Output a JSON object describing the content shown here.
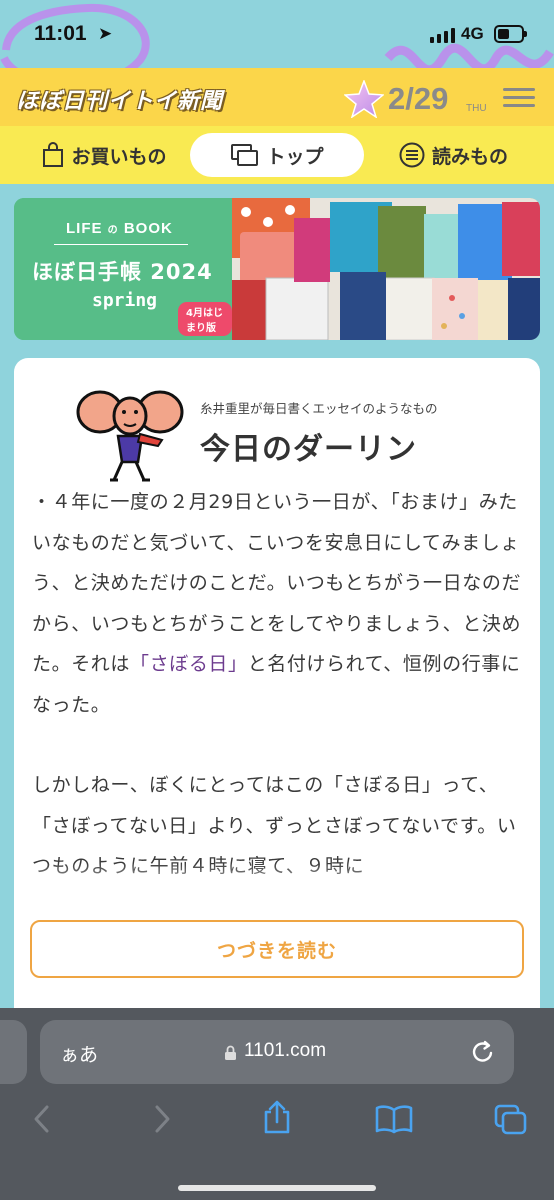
{
  "status_bar": {
    "time": "11:01",
    "network": "4G"
  },
  "header": {
    "logo": "ほぼ日刊イトイ新聞",
    "date": "2/29",
    "day_of_week": "THU"
  },
  "tabs": [
    {
      "label": "お買いもの",
      "icon": "shopping-bag-icon"
    },
    {
      "label": "トップ",
      "icon": "windows-icon",
      "active": true
    },
    {
      "label": "読みもの",
      "icon": "reading-icon"
    }
  ],
  "banner": {
    "brand_prefix": "LIFE",
    "brand_mid": "の",
    "brand_suffix": "BOOK",
    "title": "ほぼ日手帳 2024",
    "season": "spring",
    "badge": "4月はじまり版"
  },
  "article": {
    "kicker": "糸井重里が毎日書くエッセイのようなもの",
    "title": "今日のダーリン",
    "para1_part1": "・４年に一度の２月29日という一日が、「おまけ」みたいなものだと気づいて、こいつを安息日にしてみましょう、と決めただけのことだ。いつもとちがう一日なのだから、いつもとちがうことをしてやりましょう、と決めた。それは",
    "para1_link": "「さぼる日」",
    "para1_part2": "と名付けられて、恒例の行事になった。",
    "para2": "しかしねー、ぼくにとってはこの「さぼる日」って、「さぼってない日」より、ずっとさぼってないです。いつものように午前４時に寝て、９時に",
    "read_more": "つづきを読む"
  },
  "browser": {
    "aa_label": "ぁあ",
    "url": "1101.com"
  },
  "colors": {
    "page_bg": "#8fd3dc",
    "header_yellow": "#fbd64a",
    "tabs_yellow": "#f9ea52",
    "accent_orange": "#efa543",
    "link_purple": "#6c3b8e",
    "ios_blue": "#4aa3f0"
  }
}
